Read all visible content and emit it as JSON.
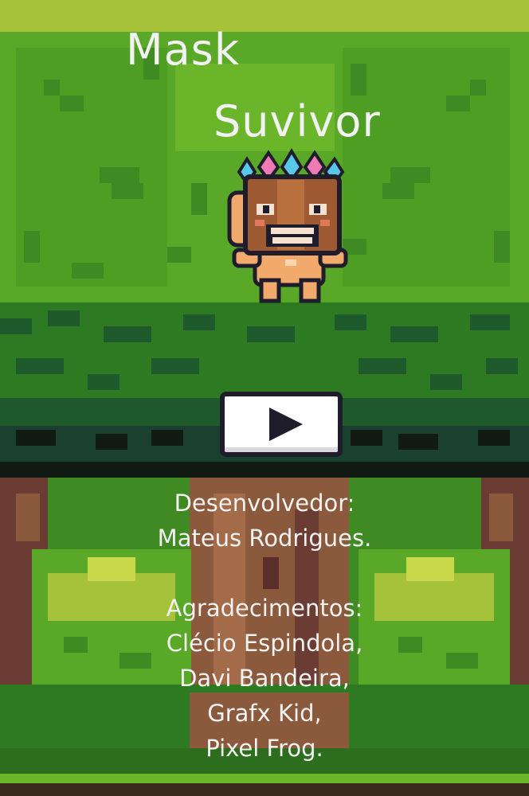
{
  "game": {
    "title_line_1": "Mask",
    "title_line_2": "Suvivor"
  },
  "menu": {
    "play_icon": "play-triangle-icon"
  },
  "credits": {
    "developer_heading": "Desenvolvedor:",
    "developer_name": "Mateus Rodrigues.",
    "thanks_heading": "Agradecimentos:",
    "thanks": [
      "Clécio Espindola,",
      "Davi Bandeira,",
      "Grafx Kid,",
      "Pixel Frog."
    ]
  },
  "colors": {
    "title_text": "#f2f2f2",
    "leaf_light": "#6bb52b",
    "leaf_mid": "#4e9e24",
    "leaf_dark": "#2d6e1e",
    "leaf_shadow": "#1e4d2b",
    "trunk": "#8b5a3c",
    "button_fill": "#ffffff",
    "button_outline": "#1f1d2c"
  }
}
